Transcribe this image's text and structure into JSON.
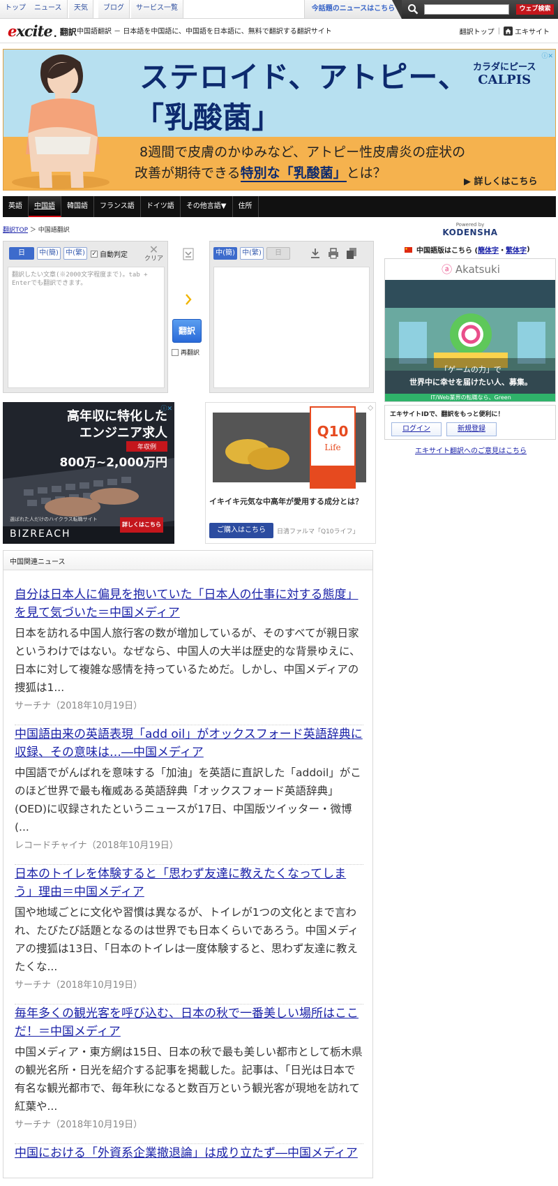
{
  "topbar": {
    "links": [
      "トップ",
      "ニュース",
      "天気",
      "ブログ",
      "サービス一覧"
    ],
    "news_link": "今話題のニュースはこちら",
    "search_placeholder": "",
    "search_button": "ウェブ検索"
  },
  "header": {
    "logo_text": "excite",
    "logo_suffix": "翻訳",
    "tagline": "中国語翻訳 － 日本語を中国語に、中国語を日本語に、無料で翻訳する翻訳サイト",
    "right_link_1": "翻訳トップ",
    "right_link_2": "エキサイト"
  },
  "banner": {
    "headline_1": "ステロイド、アトピー、",
    "headline_2": "「乳酸菌」",
    "line_1": "8週間で皮膚のかゆみなど、アトピー性皮膚炎の症状の",
    "line_2_prefix": "改善が期待できる",
    "line_2_bold": "特別な「乳酸菌」",
    "line_2_suffix": "とは？",
    "cta": "詳しくはこちら",
    "brand_1": "カラダにピース",
    "brand_2": "CALPIS"
  },
  "langnav": {
    "tabs": [
      "英語",
      "中国語",
      "韓国語",
      "フランス語",
      "ドイツ語",
      "その他言語▼",
      "住所"
    ],
    "active_index": 1
  },
  "breadcrumb": {
    "home": "翻訳TOP",
    "sep": "＞",
    "current": "中国語翻訳"
  },
  "translator": {
    "src_chips": [
      "日",
      "中(簡)",
      "中(繁)"
    ],
    "auto_detect": "自動判定",
    "clear": "クリア",
    "src_placeholder": "翻訳したい文章(※2000文字程度まで)。tab + Enterでも翻訳できます。",
    "dst_chips": [
      "中(簡)",
      "中(繁)",
      "日"
    ],
    "translate_button": "翻訳",
    "retranslate": "再翻訳"
  },
  "sidebar": {
    "powered_by": "Powered by",
    "kodensha": "KODENSHA",
    "version_prefix": "中国語版はこちら (",
    "simplified": "簡体字",
    "dot": "・",
    "traditional": "繁体字",
    "version_suffix": " )",
    "ad_brand": "Akatsuki",
    "ad_text_1": "「ゲームの力」で",
    "ad_text_2": "世界中に幸せを届けたい人、募集。",
    "ad_bar": "IT/Web業界の転職なら、Green",
    "login_title": "エキサイトIDで、翻訳をもっと便利に！",
    "login_button": "ログイン",
    "register_button": "新規登録",
    "feedback": "エキサイト翻訳へのご意見はこちら"
  },
  "ads": {
    "bizreach_1": "高年収に特化した",
    "bizreach_2": "エンジニア求人",
    "bizreach_tag": "年収例",
    "bizreach_salary": "800万~2,000万円",
    "bizreach_small": "選ばれた人だけのハイクラス転職サイト",
    "bizreach_logo": "BIZREACH",
    "bizreach_cta": "詳しくはこちら",
    "q10_label": "Q10",
    "q10_sub": "Life",
    "q10_title": "イキイキ元気な中高年が愛用する成分とは？",
    "q10_button": "ご購入はこちら",
    "q10_sponsor": "日清ファルマ「Q10ライフ」"
  },
  "news": {
    "heading": "中国関連ニュース",
    "articles": [
      {
        "title": "自分は日本人に偏見を抱いていた「日本人の仕事に対する態度」を見て気づいた＝中国メディア",
        "body": "日本を訪れる中国人旅行客の数が増加しているが、そのすべてが親日家というわけではない。なぜなら、中国人の大半は歴史的な背景ゆえに、日本に対して複雑な感情を持っているためだ。しかし、中国メディアの捜狐は1...",
        "source": "サーチナ（2018年10月19日）"
      },
      {
        "title": "中国語由来の英語表現「add oil」がオックスフォード英語辞典に収録、その意味は…―中国メディア",
        "body": "中国語でがんばれを意味する「加油」を英語に直訳した「addoil」がこのほど世界で最も権威ある英語辞典「オックスフォード英語辞典」(OED)に収録されたというニュースが17日、中国版ツイッター・微博(...",
        "source": "レコードチャイナ（2018年10月19日）"
      },
      {
        "title": "日本のトイレを体験すると「思わず友達に教えたくなってしまう」理由＝中国メディア",
        "body": "国や地域ごとに文化や習慣は異なるが、トイレが1つの文化とまで言われ、たびたび話題となるのは世界でも日本くらいであろう。中国メディアの捜狐は13日、「日本のトイレは一度体験すると、思わず友達に教えたくな...",
        "source": "サーチナ（2018年10月19日）"
      },
      {
        "title": "毎年多くの観光客を呼び込む、日本の秋で一番美しい場所はここだ！＝中国メディア",
        "body": "中国メディア・東方網は15日、日本の秋で最も美しい都市として栃木県の観光名所・日光を紹介する記事を掲載した。記事は、「日光は日本で有名な観光都市で、毎年秋になると数百万という観光客が現地を訪れて紅葉や...",
        "source": "サーチナ（2018年10月19日）"
      },
      {
        "title": "中国における「外資系企業撤退論」は成り立たず―中国メディア",
        "body": "",
        "source": ""
      }
    ]
  }
}
